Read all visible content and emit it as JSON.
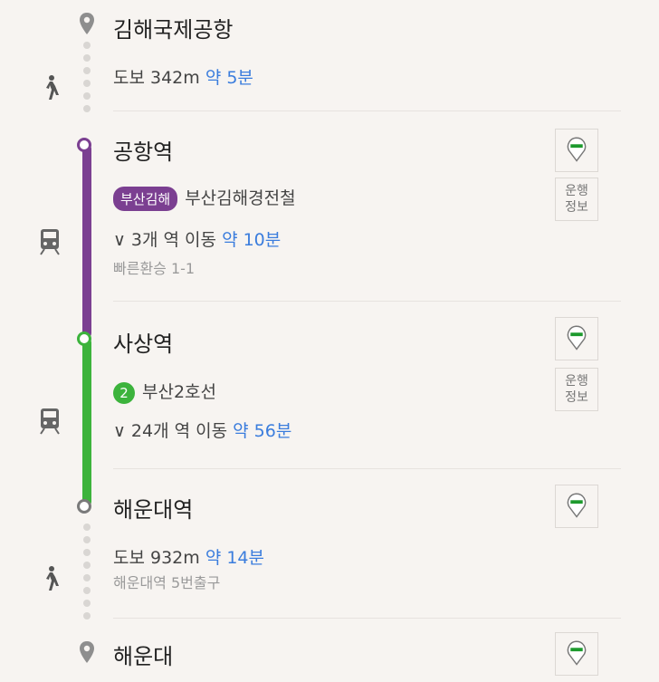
{
  "origin": {
    "name": "김해국제공항"
  },
  "walk1": {
    "text": "도보 342m",
    "duration": "약 5분"
  },
  "stop1": {
    "name": "공항역"
  },
  "line1": {
    "badge": "부산김해",
    "name": "부산김해경전철",
    "stops": "3개 역 이동",
    "duration": "약 10분",
    "transfer": "빠른환승 1-1",
    "color": "#7b3f91"
  },
  "stop2": {
    "name": "사상역"
  },
  "line2": {
    "badge": "2",
    "name": "부산2호선",
    "stops": "24개 역 이동",
    "duration": "약 56분",
    "color": "#3cb33c"
  },
  "stop3": {
    "name": "해운대역"
  },
  "walk2": {
    "text": "도보 932m",
    "duration": "약 14분",
    "exit": "해운대역 5번출구"
  },
  "destination": {
    "name": "해운대"
  },
  "operation_info": {
    "line1": "운행",
    "line2": "정보"
  },
  "icons": [
    "location-pin-icon",
    "walk-icon",
    "train-icon",
    "alarm-pin-icon",
    "chevron-down-icon"
  ]
}
